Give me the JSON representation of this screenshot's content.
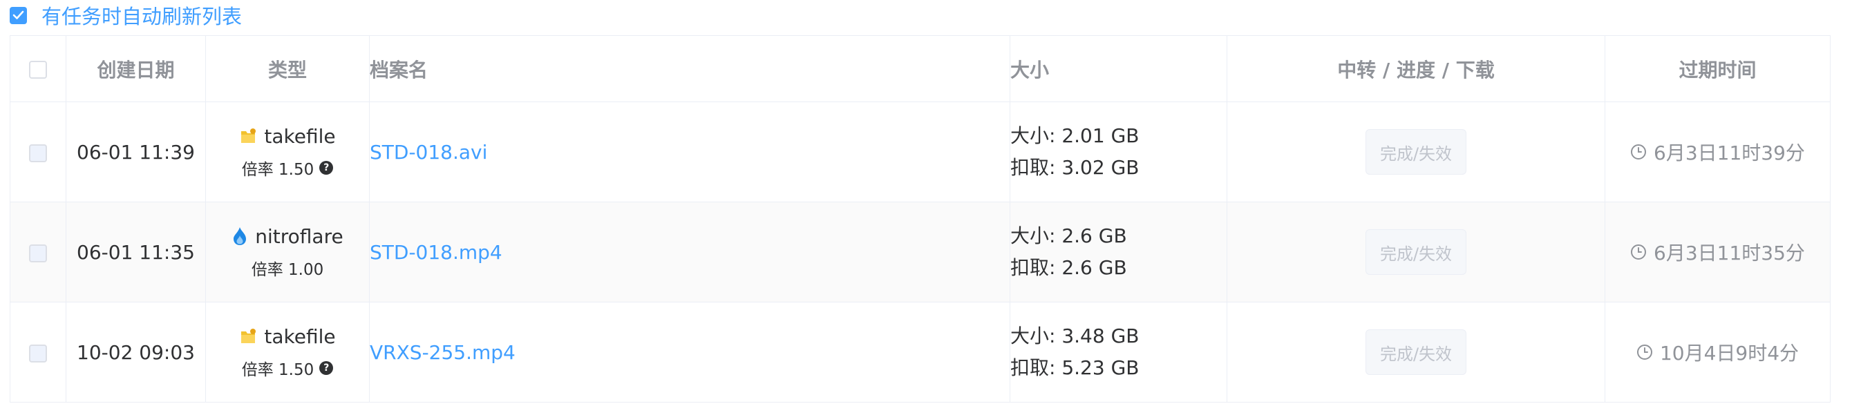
{
  "refresh": {
    "label": "有任务时自动刷新列表",
    "checked": true
  },
  "columns": {
    "date": "创建日期",
    "type": "类型",
    "name": "档案名",
    "size": "大小",
    "progress": "中转 / 进度 / 下载",
    "expire": "过期时间"
  },
  "rows": [
    {
      "date": "06-01 11:39",
      "host": "takefile",
      "host_icon": "takefile-icon",
      "ratio": "倍率 1.50",
      "has_help": true,
      "file": "STD-018.avi",
      "size": "大小: 2.01 GB",
      "deduct": "扣取: 3.02 GB",
      "status": "完成/失效",
      "expire": "6月3日11时39分"
    },
    {
      "date": "06-01 11:35",
      "host": "nitroflare",
      "host_icon": "nitroflare-icon",
      "ratio": "倍率 1.00",
      "has_help": false,
      "file": "STD-018.mp4",
      "size": "大小: 2.6 GB",
      "deduct": "扣取: 2.6 GB",
      "status": "完成/失效",
      "expire": "6月3日11时35分"
    },
    {
      "date": "10-02 09:03",
      "host": "takefile",
      "host_icon": "takefile-icon",
      "ratio": "倍率 1.50",
      "has_help": true,
      "file": "VRXS-255.mp4",
      "size": "大小: 3.48 GB",
      "deduct": "扣取: 5.23 GB",
      "status": "完成/失效",
      "expire": "10月4日9时4分"
    }
  ],
  "colors": {
    "accent": "#409eff",
    "header_text": "#909399",
    "stripe": "#fafafa",
    "border": "#ebeef5",
    "takefile": "#f2c230",
    "nitroflare": "#1e88e5"
  }
}
